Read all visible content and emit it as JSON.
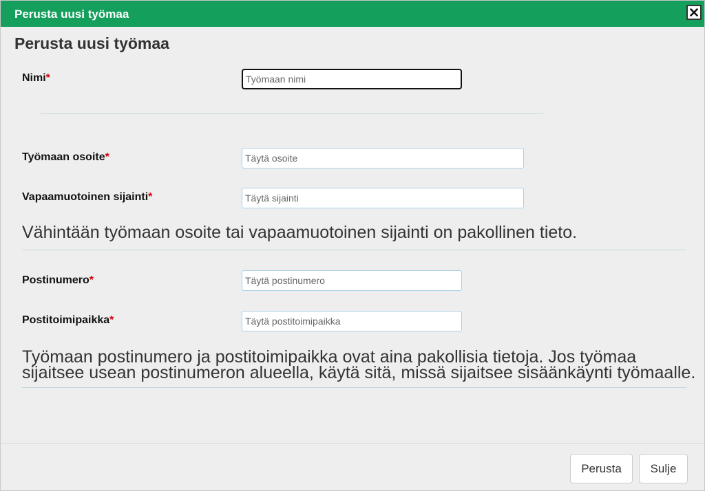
{
  "window": {
    "title": "Perusta uusi työmaa"
  },
  "form": {
    "heading": "Perusta uusi työmaa",
    "required_mark": "*",
    "fields": {
      "name": {
        "label": "Nimi",
        "placeholder": "Työmaan nimi",
        "value": ""
      },
      "address": {
        "label": "Työmaan osoite",
        "placeholder": "Täytä osoite",
        "value": ""
      },
      "location": {
        "label": "Vapaamuotoinen sijainti",
        "placeholder": "Täytä sijainti",
        "value": ""
      },
      "postal_code": {
        "label": "Postinumero",
        "placeholder": "Täytä postinumero",
        "value": ""
      },
      "city": {
        "label": "Postitoimipaikka",
        "placeholder": "Täytä postitoimipaikka",
        "value": ""
      }
    },
    "notes": {
      "address_note": "Vähintään työmaan osoite tai vapaamuotoinen sijainti on pakollinen tieto.",
      "postal_note_line1": "Työmaan postinumero ja postitoimipaikka ovat aina pakollisia tietoja. Jos työmaa",
      "postal_note_line2": "sijaitsee usean postinumeron alueella, käytä sitä, missä sijaitsee sisäänkäynti työmaalle."
    }
  },
  "footer": {
    "submit_label": "Perusta",
    "close_label": "Sulje"
  },
  "colors": {
    "titlebar": "#159f5c",
    "required": "#d9000c"
  }
}
